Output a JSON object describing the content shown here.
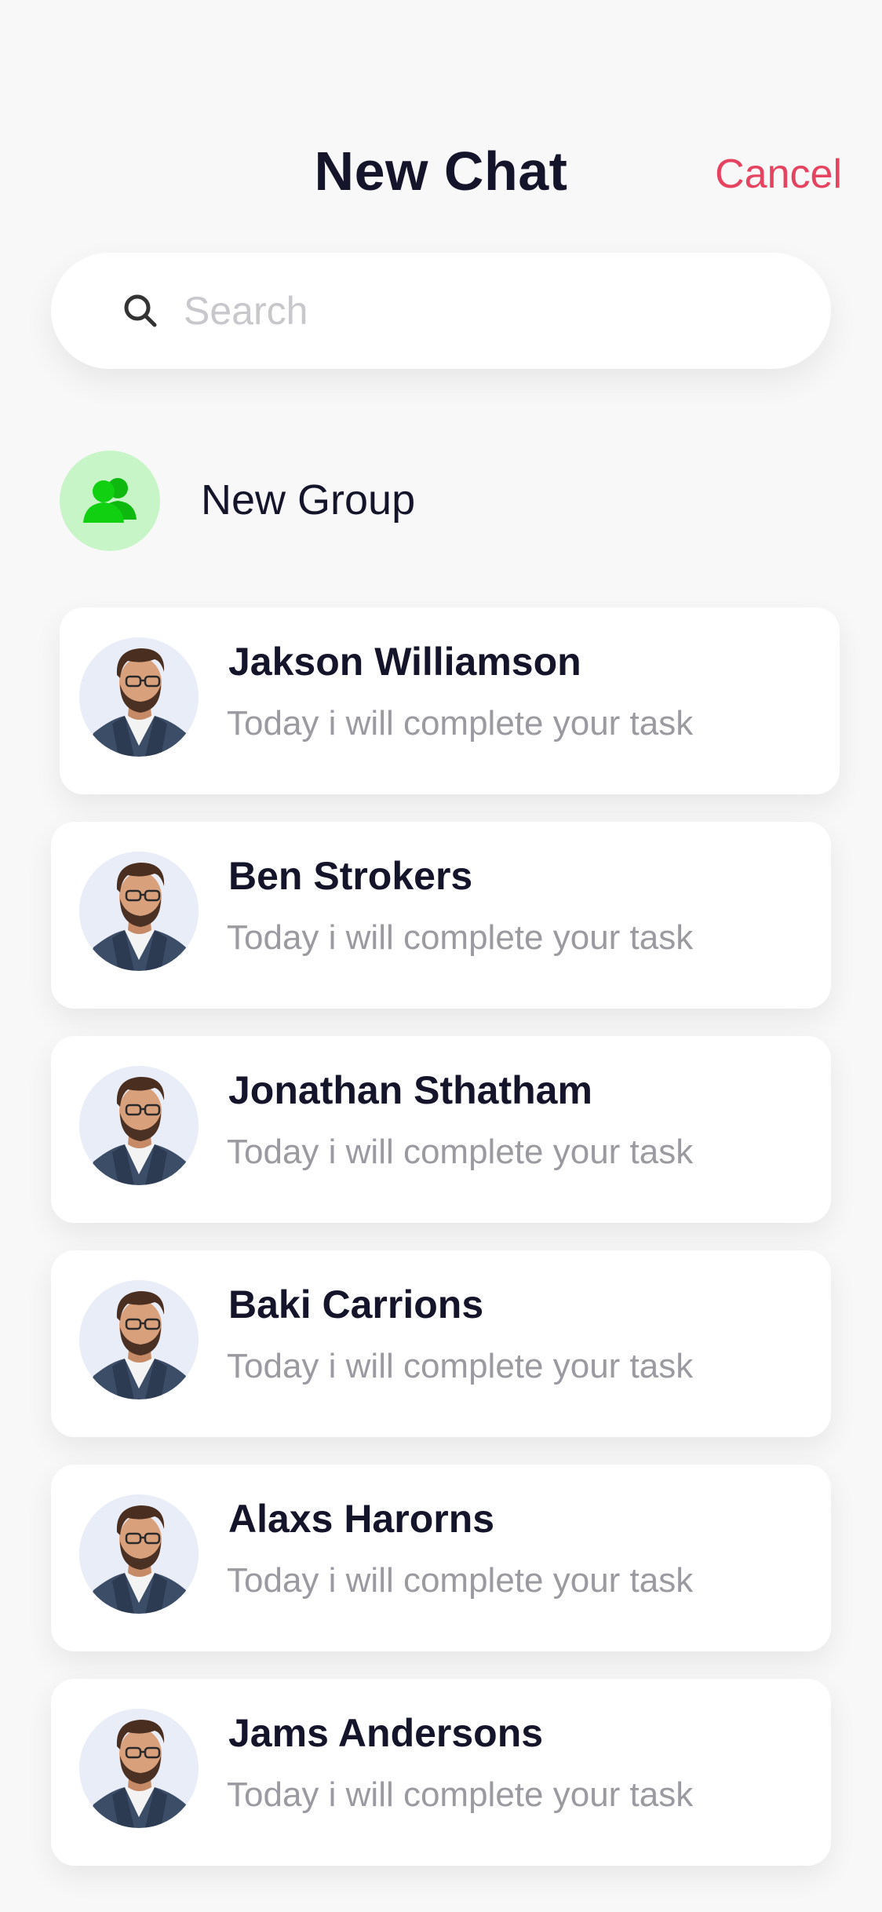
{
  "header": {
    "title": "New Chat",
    "cancel_label": "Cancel",
    "cancel_color": "#e5435f"
  },
  "search": {
    "placeholder": "Search",
    "value": "",
    "icon": "search-icon"
  },
  "new_group": {
    "label": "New Group",
    "icon": "group-icon",
    "icon_color": "#11c711",
    "icon_bg": "#c8f5c8"
  },
  "contacts": [
    {
      "name": "Jakson Williamson",
      "message": "Today i will complete your task",
      "avatar": "avatar-photo"
    },
    {
      "name": "Ben Strokers",
      "message": "Today i will complete your task",
      "avatar": "avatar-photo"
    },
    {
      "name": "Jonathan Sthatham",
      "message": "Today i will complete your task",
      "avatar": "avatar-photo"
    },
    {
      "name": "Baki Carrions",
      "message": "Today i will complete your task",
      "avatar": "avatar-photo"
    },
    {
      "name": "Alaxs Harorns",
      "message": "Today i will complete your task",
      "avatar": "avatar-photo"
    },
    {
      "name": "Jams Andersons",
      "message": "Today i will complete your task",
      "avatar": "avatar-photo"
    }
  ]
}
